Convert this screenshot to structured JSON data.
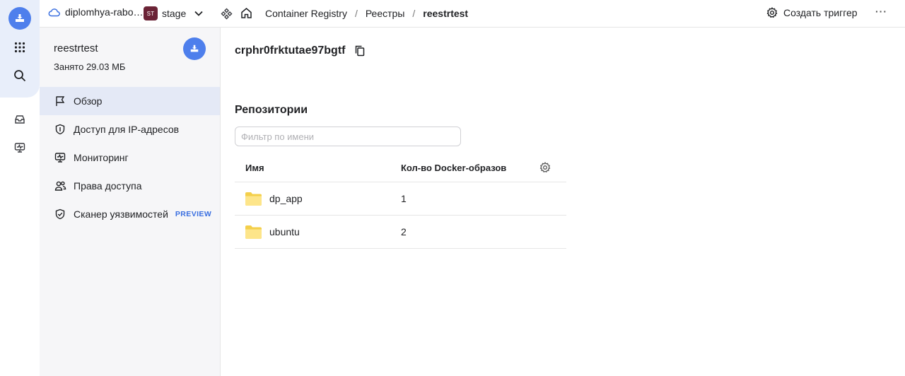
{
  "rail": {
    "logo_icon": "container-registry-icon",
    "items": [
      {
        "icon": "apps-grid-icon"
      },
      {
        "icon": "search-icon"
      },
      {
        "icon": "inbox-icon"
      },
      {
        "icon": "monitoring-icon"
      }
    ]
  },
  "topbar": {
    "cloud_name": "diplomhya-rabo…",
    "folder_badge": "ST",
    "folder_name": "stage",
    "breadcrumbs": [
      "Container Registry",
      "Реестры",
      "reestrtest"
    ],
    "separator": "/",
    "create_trigger_label": "Создать триггер",
    "more_label": "···"
  },
  "sidebar": {
    "title": "reestrtest",
    "usage": "Занято 29.03 МБ",
    "items": [
      {
        "label": "Обзор",
        "icon": "flag-icon",
        "active": true
      },
      {
        "label": "Доступ для IP-адресов",
        "icon": "shield-icon"
      },
      {
        "label": "Мониторинг",
        "icon": "monitor-icon"
      },
      {
        "label": "Права доступа",
        "icon": "users-icon"
      },
      {
        "label": "Сканер уязвимостей",
        "icon": "shield-check-icon",
        "badge": "PREVIEW"
      }
    ]
  },
  "main": {
    "registry_id": "crphr0frktutae97bgtf",
    "section_title": "Репозитории",
    "filter_placeholder": "Фильтр по имени",
    "table": {
      "columns": [
        "Имя",
        "Кол-во Docker-образов"
      ],
      "rows": [
        {
          "name": "dp_app",
          "count": "1"
        },
        {
          "name": "ubuntu",
          "count": "2"
        }
      ]
    }
  },
  "colors": {
    "accent": "#4e7fec",
    "active_nav": "#e4e9f6",
    "badge_bg": "#6b2336",
    "folder_yellow": "#fde58a",
    "preview": "#3a6fe0"
  }
}
